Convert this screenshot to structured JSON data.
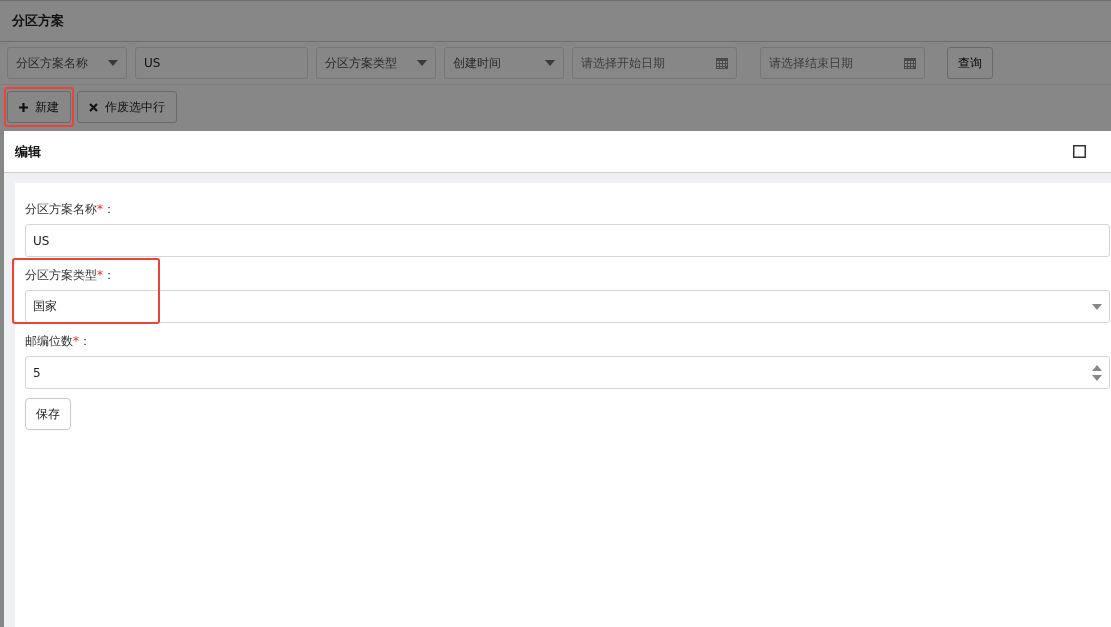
{
  "page": {
    "title": "分区方案"
  },
  "filters": [
    {
      "kind": "select",
      "value": "分区方案名称"
    },
    {
      "kind": "input",
      "value": "US"
    },
    {
      "kind": "select",
      "value": "分区方案类型"
    },
    {
      "kind": "select",
      "value": "创建时间"
    },
    {
      "kind": "date",
      "placeholder": "请选择开始日期"
    },
    {
      "kind": "date",
      "placeholder": "请选择结束日期"
    },
    {
      "kind": "button",
      "label": "查询"
    }
  ],
  "actions": [
    {
      "kind": "add",
      "label": "新建",
      "highlighted": true
    },
    {
      "kind": "void",
      "label": "作废选中行",
      "highlighted": false
    }
  ],
  "dialog": {
    "title": "编辑",
    "fields": [
      {
        "kind": "text",
        "label": "分区方案名称",
        "required_mark": "*",
        "colon": "：",
        "value": "US",
        "highlighted": false
      },
      {
        "kind": "select",
        "label": "分区方案类型",
        "required_mark": "*",
        "colon": "：",
        "value": "国家",
        "highlighted": true
      },
      {
        "kind": "number",
        "label": "邮编位数",
        "required_mark": "*",
        "colon": "：",
        "value": "5",
        "highlighted": false
      }
    ],
    "save": "保存"
  }
}
